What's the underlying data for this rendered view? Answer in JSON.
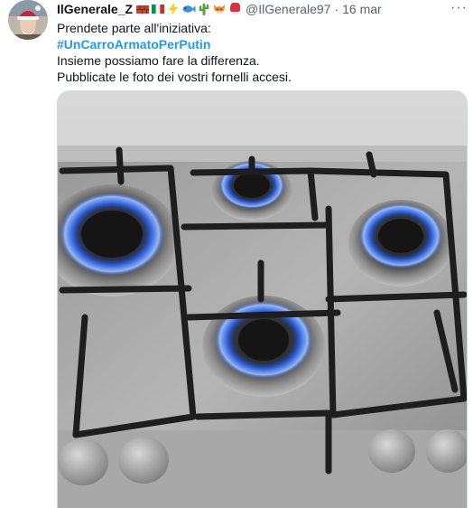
{
  "tweet": {
    "author_name": "IlGenerale_Z",
    "author_handle": "@IlGenerale97",
    "separator": "·",
    "date": "16 mar",
    "more_label": "···",
    "lines": [
      "Prendete parte all'iniziativa:",
      "#UnCarroArmatoPerPutin",
      "Insieme possiamo fare la differenza.",
      "Pubblicate le foto dei vostri fornelli accesi."
    ],
    "name_emojis": [
      "brick-emoji",
      "italy-flag-emoji",
      "lightning-emoji",
      "fish-emoji",
      "cactus-emoji",
      "fox-emoji",
      "boxing-glove-emoji"
    ],
    "media": {
      "subject": "gas-stove-photo",
      "flame_color": "#2f6bff"
    }
  },
  "colors": {
    "text": "#0f1419",
    "secondary": "#536471",
    "link": "#1d9bf0"
  }
}
